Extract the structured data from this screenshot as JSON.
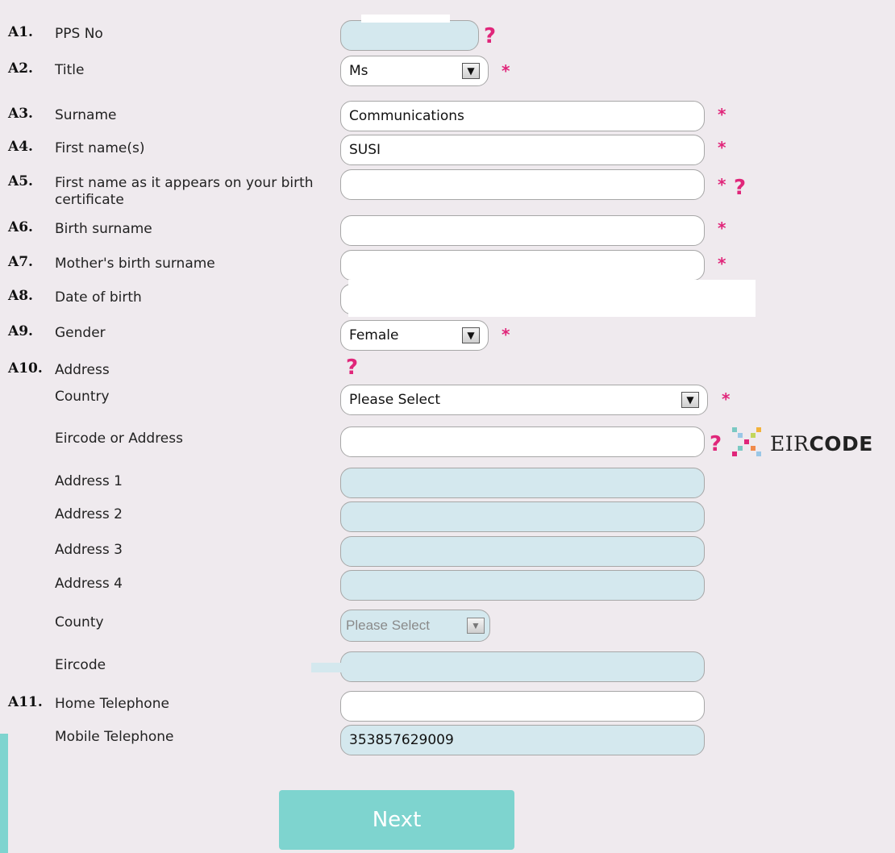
{
  "rows": [
    {
      "num": "A1.",
      "label": "PPS No"
    },
    {
      "num": "A2.",
      "label": "Title"
    },
    {
      "num": "A3.",
      "label": "Surname"
    },
    {
      "num": "A4.",
      "label": "First name(s)"
    },
    {
      "num": "A5.",
      "label": "First name as it appears on your birth certificate"
    },
    {
      "num": "A6.",
      "label": "Birth surname"
    },
    {
      "num": "A7.",
      "label": "Mother's birth surname"
    },
    {
      "num": "A8.",
      "label": "Date of birth"
    },
    {
      "num": "A9.",
      "label": "Gender"
    },
    {
      "num": "A10.",
      "label": "Address"
    },
    {
      "num": "",
      "label": "Country"
    },
    {
      "num": "",
      "label": "Eircode or Address"
    },
    {
      "num": "",
      "label": "Address 1"
    },
    {
      "num": "",
      "label": "Address 2"
    },
    {
      "num": "",
      "label": "Address 3"
    },
    {
      "num": "",
      "label": "Address 4"
    },
    {
      "num": "",
      "label": "County"
    },
    {
      "num": "",
      "label": "Eircode"
    },
    {
      "num": "A11.",
      "label": "Home Telephone"
    },
    {
      "num": "",
      "label": "Mobile Telephone"
    }
  ],
  "fields": {
    "pps": {
      "value": ""
    },
    "title": {
      "value": "Ms"
    },
    "surname": {
      "value": "Communications"
    },
    "first_name": {
      "value": "SUSI"
    },
    "birth_cert_name": {
      "value": ""
    },
    "birth_surname": {
      "value": ""
    },
    "mother_surname": {
      "value": ""
    },
    "dob": {
      "value": ""
    },
    "gender": {
      "value": "Female"
    },
    "country": {
      "value": "Please Select"
    },
    "eircode_or_address": {
      "value": ""
    },
    "address1": {
      "value": ""
    },
    "address2": {
      "value": ""
    },
    "address3": {
      "value": ""
    },
    "address4": {
      "value": ""
    },
    "county": {
      "value": "Please Select"
    },
    "eircode": {
      "value": ""
    },
    "home_phone": {
      "value": ""
    },
    "mobile_phone": {
      "value": "353857629009"
    }
  },
  "symbols": {
    "required": "*",
    "help": "?",
    "dropdown_arrow": "▼"
  },
  "eircode_brand": {
    "prefix": "EIR",
    "suffix": "CODE"
  },
  "buttons": {
    "next": "Next"
  },
  "colors": {
    "accent": "#e0267a",
    "button": "#7ed4cf",
    "disabled_field": "#d4e8ee"
  }
}
